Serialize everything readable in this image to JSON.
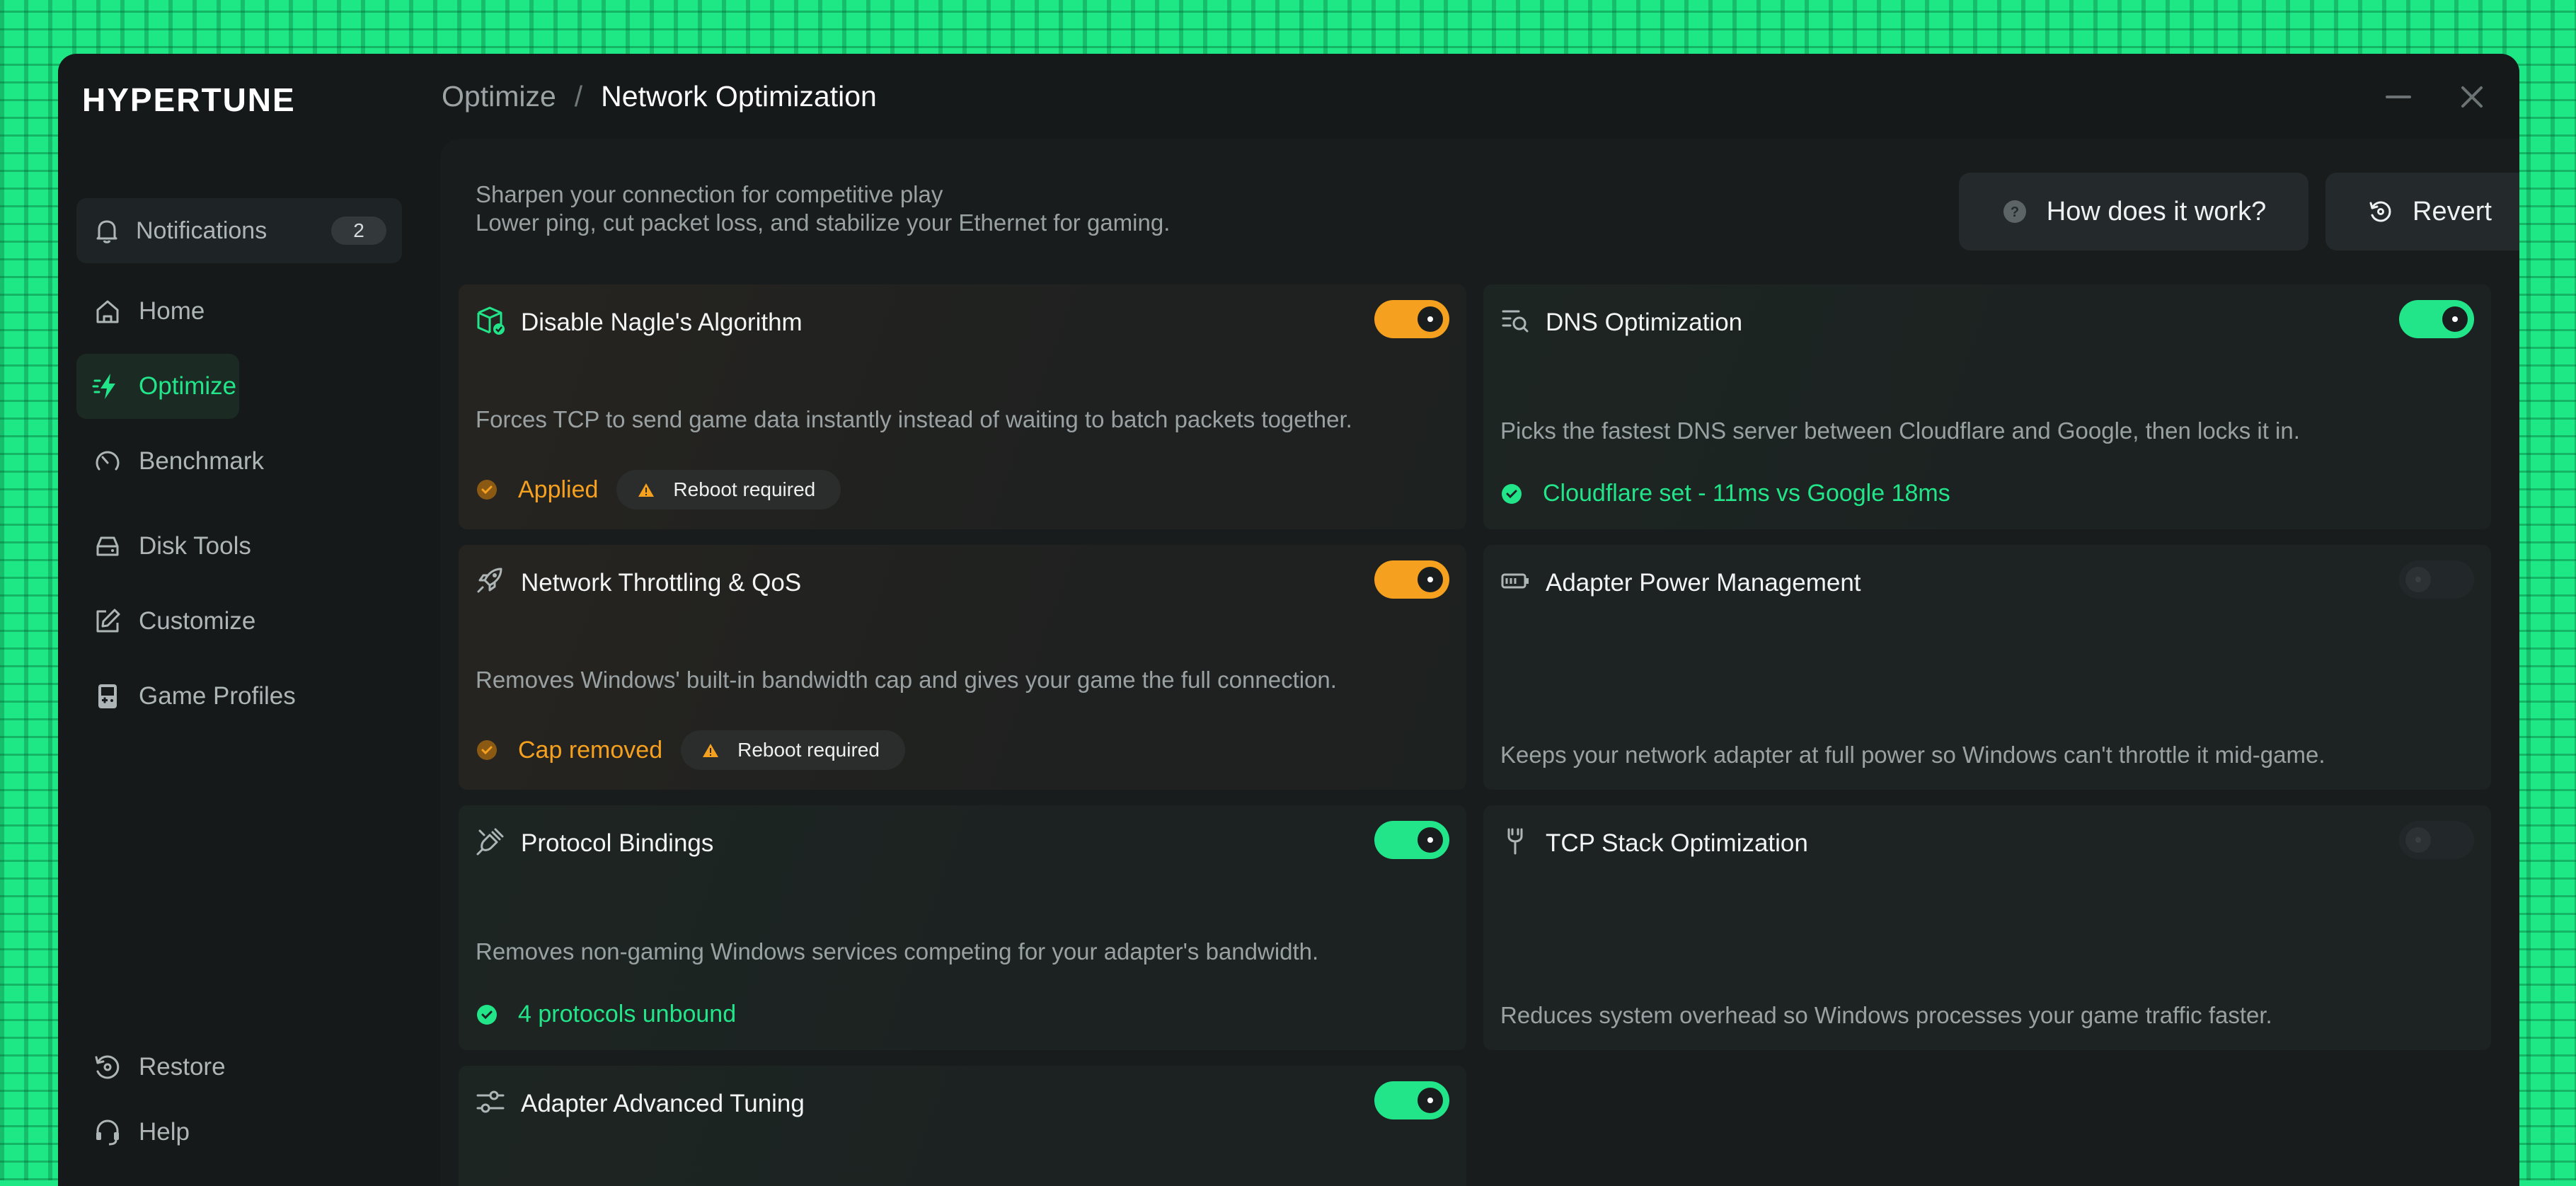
{
  "app": {
    "logo": "HYPERTUNE",
    "breadcrumb": {
      "parent": "Optimize",
      "separator": "/",
      "current": "Network Optimization"
    }
  },
  "colors": {
    "accent_green": "#22e58a",
    "accent_orange": "#f5a01e",
    "background": "#1ee885"
  },
  "sidebar": {
    "notifications": {
      "label": "Notifications",
      "count": "2",
      "icon": "bell-icon"
    },
    "nav": [
      {
        "label": "Home",
        "icon": "home-icon",
        "active": false
      },
      {
        "label": "Optimize",
        "icon": "lightning-icon",
        "active": true
      },
      {
        "label": "Benchmark",
        "icon": "gauge-icon",
        "active": false
      },
      {
        "label": "Disk Tools",
        "icon": "disk-icon",
        "active": false
      },
      {
        "label": "Customize",
        "icon": "edit-icon",
        "active": false
      },
      {
        "label": "Game Profiles",
        "icon": "gamepad-icon",
        "active": false
      }
    ],
    "footer": [
      {
        "label": "Restore",
        "icon": "restore-icon"
      },
      {
        "label": "Help",
        "icon": "headset-icon"
      }
    ]
  },
  "main": {
    "intro_line1": "Sharpen your connection for competitive play",
    "intro_line2": "Lower ping, cut packet loss, and stabilize your Ethernet for gaming.",
    "how_button": "How does it work?",
    "revert_button": "Revert",
    "cards": [
      {
        "title": "Disable Nagle's Algorithm",
        "description": "Forces TCP to send game data instantly instead of waiting to batch packets together.",
        "toggle": "on",
        "status": "Applied",
        "status_color": "orange",
        "pill": "Reboot required",
        "icon": "package-icon"
      },
      {
        "title": "DNS Optimization",
        "description": "Picks the fastest DNS server between Cloudflare and Google, then locks it in.",
        "toggle": "on",
        "status": "Cloudflare set - 11ms vs Google 18ms",
        "status_color": "green",
        "icon": "search-list-icon"
      },
      {
        "title": "Network Throttling & QoS",
        "description": "Removes Windows' built-in bandwidth cap and gives your game the full connection.",
        "toggle": "on",
        "status": "Cap removed",
        "status_color": "orange",
        "pill": "Reboot required",
        "icon": "rocket-icon"
      },
      {
        "title": "Adapter Power Management",
        "description": "Keeps your network adapter at full power so Windows can't throttle it mid-game.",
        "toggle": "off",
        "icon": "battery-icon"
      },
      {
        "title": "Protocol Bindings",
        "description": "Removes non-gaming Windows services competing for your adapter's bandwidth.",
        "toggle": "on",
        "status": "4 protocols unbound",
        "status_color": "green",
        "icon": "plug-icon"
      },
      {
        "title": "TCP Stack Optimization",
        "description": "Reduces system overhead so Windows processes your game traffic faster.",
        "toggle": "off",
        "icon": "wrench-icon"
      },
      {
        "title": "Adapter Advanced Tuning",
        "toggle": "on",
        "icon": "sliders-icon"
      }
    ]
  }
}
